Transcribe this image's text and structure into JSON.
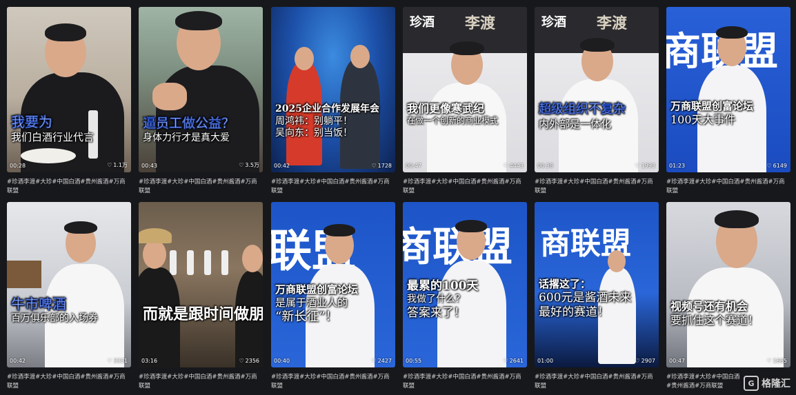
{
  "tags_text": "#珍酒李渡#大珍#中国白酒#贵州酱酒#万商联盟",
  "watermark": {
    "logo": "G",
    "text": "格隆汇"
  },
  "videos": [
    {
      "caption1": "我要为",
      "caption2": "我们白酒行业代言",
      "duration": "00:28",
      "likes": "1.1万",
      "tags": "#珍酒李渡#大珍#中国白酒#贵州酱酒#万商联盟"
    },
    {
      "caption1": "逼员工做公益？",
      "caption2": "身体力行才是真大爱",
      "duration": "00:43",
      "likes": "3.5万",
      "tags": "#珍酒李渡#大珍#中国白酒#贵州酱酒#万商联盟"
    },
    {
      "caption1": "2025企业合作发展年会",
      "caption2": "周鸿祎：别躺平！",
      "caption3": "吴向东：别当饭！",
      "duration": "00:42",
      "likes": "1728",
      "tags": "#珍酒李渡#大珍#中国白酒#贵州酱酒#万商联盟"
    },
    {
      "caption1": "我们更像寒武纪",
      "caption2": "在做一个创新的商业模式",
      "duration": "00:47",
      "likes": "4443",
      "tags": "#珍酒李渡#大珍#中国白酒#贵州酱酒#万商联盟",
      "banner1": "珍酒",
      "banner2": "李渡"
    },
    {
      "caption1": "超级组织不复杂",
      "caption2": "内外部是一体化",
      "duration": "00:38",
      "likes": "1993",
      "tags": "#珍酒李渡#大珍#中国白酒#贵州酱酒#万商联盟",
      "banner1": "珍酒",
      "banner2": "李渡"
    },
    {
      "caption1": "万商联盟创富论坛",
      "caption2": "100天大事件",
      "duration": "01:23",
      "likes": "6149",
      "tags": "#珍酒李渡#大珍#中国白酒#贵州酱酒#万商联盟",
      "banner1": "商联盟"
    },
    {
      "caption1": "牛市啤酒",
      "caption2": "百万俱乐部的入场券",
      "duration": "00:42",
      "likes": "3331",
      "tags": "#珍酒李渡#大珍#中国白酒#贵州酱酒#万商联盟"
    },
    {
      "caption1": "而就是跟时间做朋",
      "caption2": "",
      "duration": "03:16",
      "likes": "2356",
      "tags": "#珍酒李渡#大珍#中国白酒#贵州酱酒#万商联盟"
    },
    {
      "caption1": "万商联盟创富论坛",
      "caption2": "是属于酒业人的",
      "caption3": "“新长征”！",
      "duration": "00:40",
      "likes": "2427",
      "tags": "#珍酒李渡#大珍#中国白酒#贵州酱酒#万商联盟",
      "banner1": "联盟"
    },
    {
      "caption1": "最累的100天",
      "caption2": "我做了什么？",
      "caption3": "答案来了！",
      "duration": "00:55",
      "likes": "2641",
      "tags": "#珍酒李渡#大珍#中国白酒#贵州酱酒#万商联盟",
      "banner1": "商联盟"
    },
    {
      "caption1": "话撂这了：",
      "caption2": "600元是酱酒未来",
      "caption3": "最好的赛道！",
      "duration": "01:00",
      "likes": "2907",
      "tags": "#珍酒李渡#大珍#中国白酒#贵州酱酒#万商联盟",
      "banner1": "商联盟"
    },
    {
      "caption1": "视频号还有机会",
      "caption2": "要抓住这个赛道！",
      "duration": "00:47",
      "likes": "1665",
      "tags": "#珍酒李渡#大珍#中国白酒#贵州酱酒#万商联盟"
    }
  ]
}
